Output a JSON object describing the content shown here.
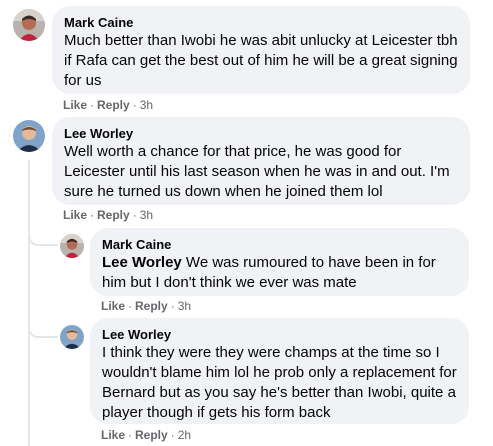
{
  "comments": [
    {
      "author": "Mark Caine",
      "avatar": "mark-caine-avatar",
      "text": "Much better than Iwobi he was abit unlucky at Leicester tbh if Rafa can get the best out of him he will be a great signing for us",
      "like": "Like",
      "reply": "Reply",
      "sep": "·",
      "time": "3h"
    },
    {
      "author": "Lee Worley",
      "avatar": "lee-worley-avatar",
      "text": "Well worth a chance for that price, he was good for Leicester until his last season when he was in and out. I'm sure he turned us down when he joined them lol",
      "like": "Like",
      "reply": "Reply",
      "sep": "·",
      "time": "3h"
    }
  ],
  "replies": [
    {
      "author": "Mark Caine",
      "avatar": "mark-caine-avatar",
      "mention": "Lee Worley",
      "text": " We was rumoured to have been in for him but I don't think we ever was mate",
      "like": "Like",
      "reply": "Reply",
      "sep": "·",
      "time": "3h"
    },
    {
      "author": "Lee Worley",
      "avatar": "lee-worley-avatar",
      "text": "I think they were they were champs at the time so I wouldn't blame him lol he prob only a replacement for Bernard but as you say he's better than Iwobi, quite a player though if gets his form back",
      "like": "Like",
      "reply": "Reply",
      "sep": "·",
      "time": "2h"
    }
  ],
  "colors": {
    "bubble": "#f0f2f5",
    "meta": "#65676b",
    "text": "#050505",
    "thread": "#e4e6eb"
  }
}
